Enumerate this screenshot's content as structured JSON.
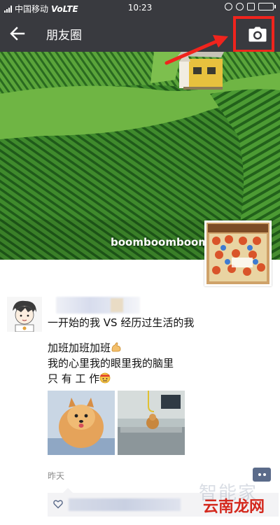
{
  "status_bar": {
    "carrier": "中国移动",
    "network": "VoLTE",
    "time": "10:23",
    "battery_level": 0.85
  },
  "title_bar": {
    "title": "朋友圈",
    "back_icon": "arrow-left-icon",
    "camera_icon": "camera-icon"
  },
  "cover": {
    "username": "boomboomboom"
  },
  "post": {
    "lines": [
      "一开始的我 VS 经历过生活的我",
      "加班加班加班",
      "我的心里我的眼里我的脑里",
      "只 有 工 作"
    ],
    "time": "昨天"
  },
  "watermarks": {
    "zhijia": "智能家",
    "yunnan": "云南龙网"
  },
  "colors": {
    "title_bar": "#393a3f",
    "highlight": "#f0241d",
    "comment_button": "#5b6b8a",
    "meta_text": "#8a8a8a"
  }
}
